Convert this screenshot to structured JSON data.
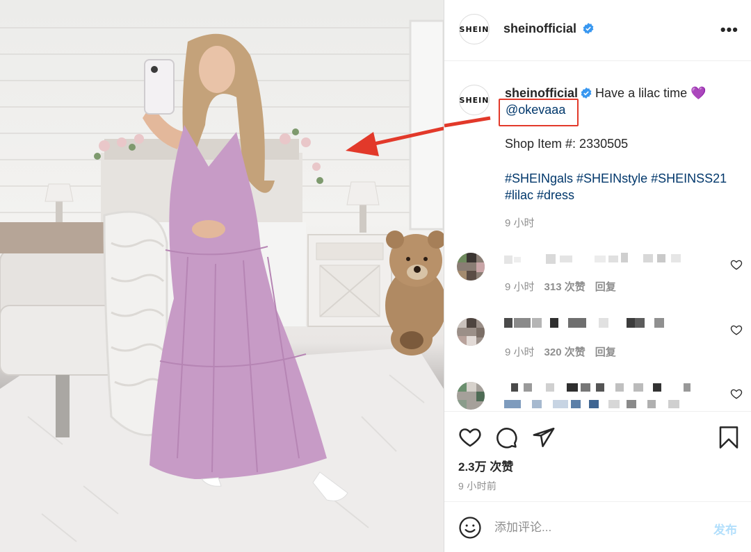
{
  "post": {
    "author": "sheinofficial",
    "avatar_text": "SHEIN",
    "more_label": "•••",
    "caption": {
      "text": "Have a lilac time 💜",
      "mention": "@okevaaa",
      "shop_item": "Shop Item #: 2330505",
      "hashtags": "#SHEINgals #SHEINstyle #SHEINSS21 #lilac #dress",
      "time": "9 小时"
    },
    "comments": [
      {
        "time": "9 小时",
        "likes": "313 次赞",
        "reply": "回复"
      },
      {
        "time": "9 小时",
        "likes": "320 次赞",
        "reply": "回复"
      },
      {
        "time": "",
        "likes": "",
        "reply": ""
      }
    ],
    "total_likes": "2.3万 次赞",
    "posted": "9 小时前",
    "add_comment": {
      "placeholder": "添加评论...",
      "post_label": "发布"
    }
  },
  "colors": {
    "link": "#00376b",
    "verified": "#3897f0",
    "annotation": "#e2392a",
    "dress": "#c79bc6",
    "post_button_disabled": "#b2dffc"
  },
  "icons": [
    "verified-badge-icon",
    "more-icon",
    "heart-icon",
    "comment-icon",
    "share-icon",
    "bookmark-icon",
    "emoji-icon",
    "annotation-arrow"
  ]
}
